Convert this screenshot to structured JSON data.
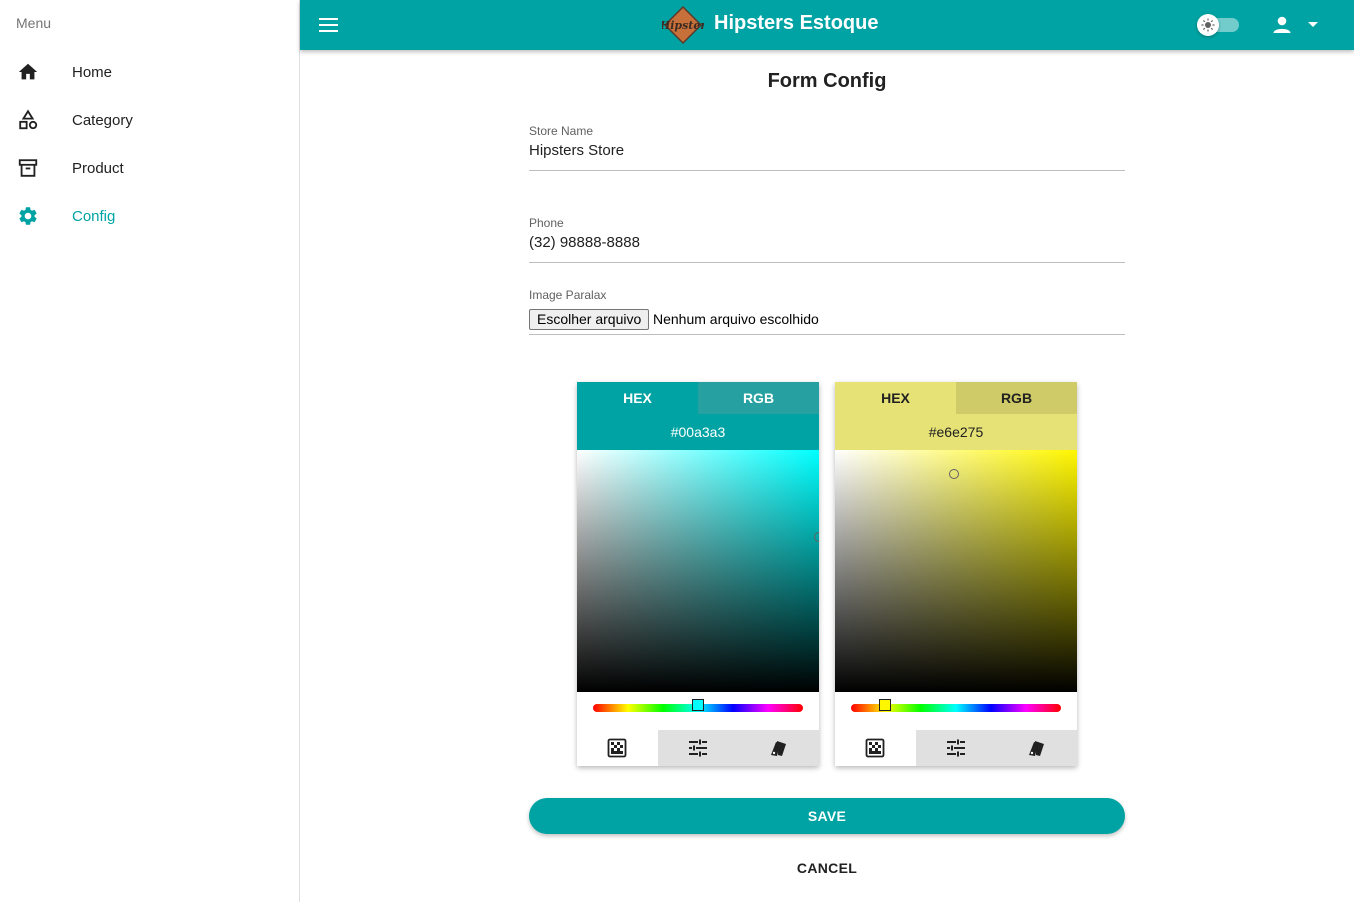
{
  "sidebar": {
    "title": "Menu",
    "items": [
      {
        "label": "Home",
        "icon": "home-icon",
        "active": false
      },
      {
        "label": "Category",
        "icon": "category-shapes-icon",
        "active": false
      },
      {
        "label": "Product",
        "icon": "archive-box-icon",
        "active": false
      },
      {
        "label": "Config",
        "icon": "gear-icon",
        "active": true
      }
    ]
  },
  "appbar": {
    "title": "Hipsters Estoque",
    "logo_text": "Hipster",
    "icons": [
      "menu-icon",
      "theme-toggle-icon",
      "account-icon",
      "dropdown-arrow-icon"
    ]
  },
  "form": {
    "title": "Form Config",
    "store_name": {
      "label": "Store Name",
      "value": "Hipsters Store"
    },
    "phone": {
      "label": "Phone",
      "value": "(32) 98888-8888"
    },
    "image_paralax": {
      "label": "Image Paralax",
      "button": "Escolher arquivo",
      "status": "Nenhum arquivo escolhido"
    },
    "save_label": "SAVE",
    "cancel_label": "CANCEL"
  },
  "pickers": [
    {
      "tabs": [
        "HEX",
        "RGB"
      ],
      "active_tab": "HEX",
      "value": "#00a3a3",
      "hue_color": "#00ffff",
      "tab_bg": "#00a3a3",
      "tab_inactive_bg": "#26a0a0",
      "text_color": "#ffffff",
      "hue_fraction": 0.5,
      "saturation": 1.0,
      "brightness": 0.64
    },
    {
      "tabs": [
        "HEX",
        "RGB"
      ],
      "active_tab": "HEX",
      "value": "#e6e275",
      "hue_color": "#fff700",
      "tab_bg": "#e6e275",
      "tab_inactive_bg": "#cfcb69",
      "text_color": "#212121",
      "hue_fraction": 0.16,
      "saturation": 0.49,
      "brightness": 0.9
    }
  ],
  "colors": {
    "primary": "#00a3a3",
    "accent_active": "#00a3a3"
  }
}
